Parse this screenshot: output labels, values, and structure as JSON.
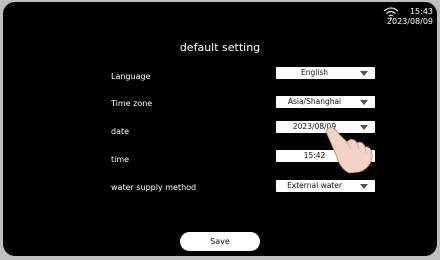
{
  "status_bar": {
    "time": "15:43",
    "date": "2023/08/09",
    "wifi_icon": "wifi-icon"
  },
  "title": "default setting",
  "settings": [
    {
      "label": "Language",
      "value": "English"
    },
    {
      "label": "Time zone",
      "value": "Asia/Shanghai"
    },
    {
      "label": "date",
      "value": "2023/08/09"
    },
    {
      "label": "time",
      "value": "15:42"
    },
    {
      "label": "water supply method",
      "value": "External water"
    }
  ],
  "save_label": "Save",
  "colors": {
    "background": "#000000",
    "control_bg": "#ffffff",
    "bezel": "#bfbfbf"
  }
}
